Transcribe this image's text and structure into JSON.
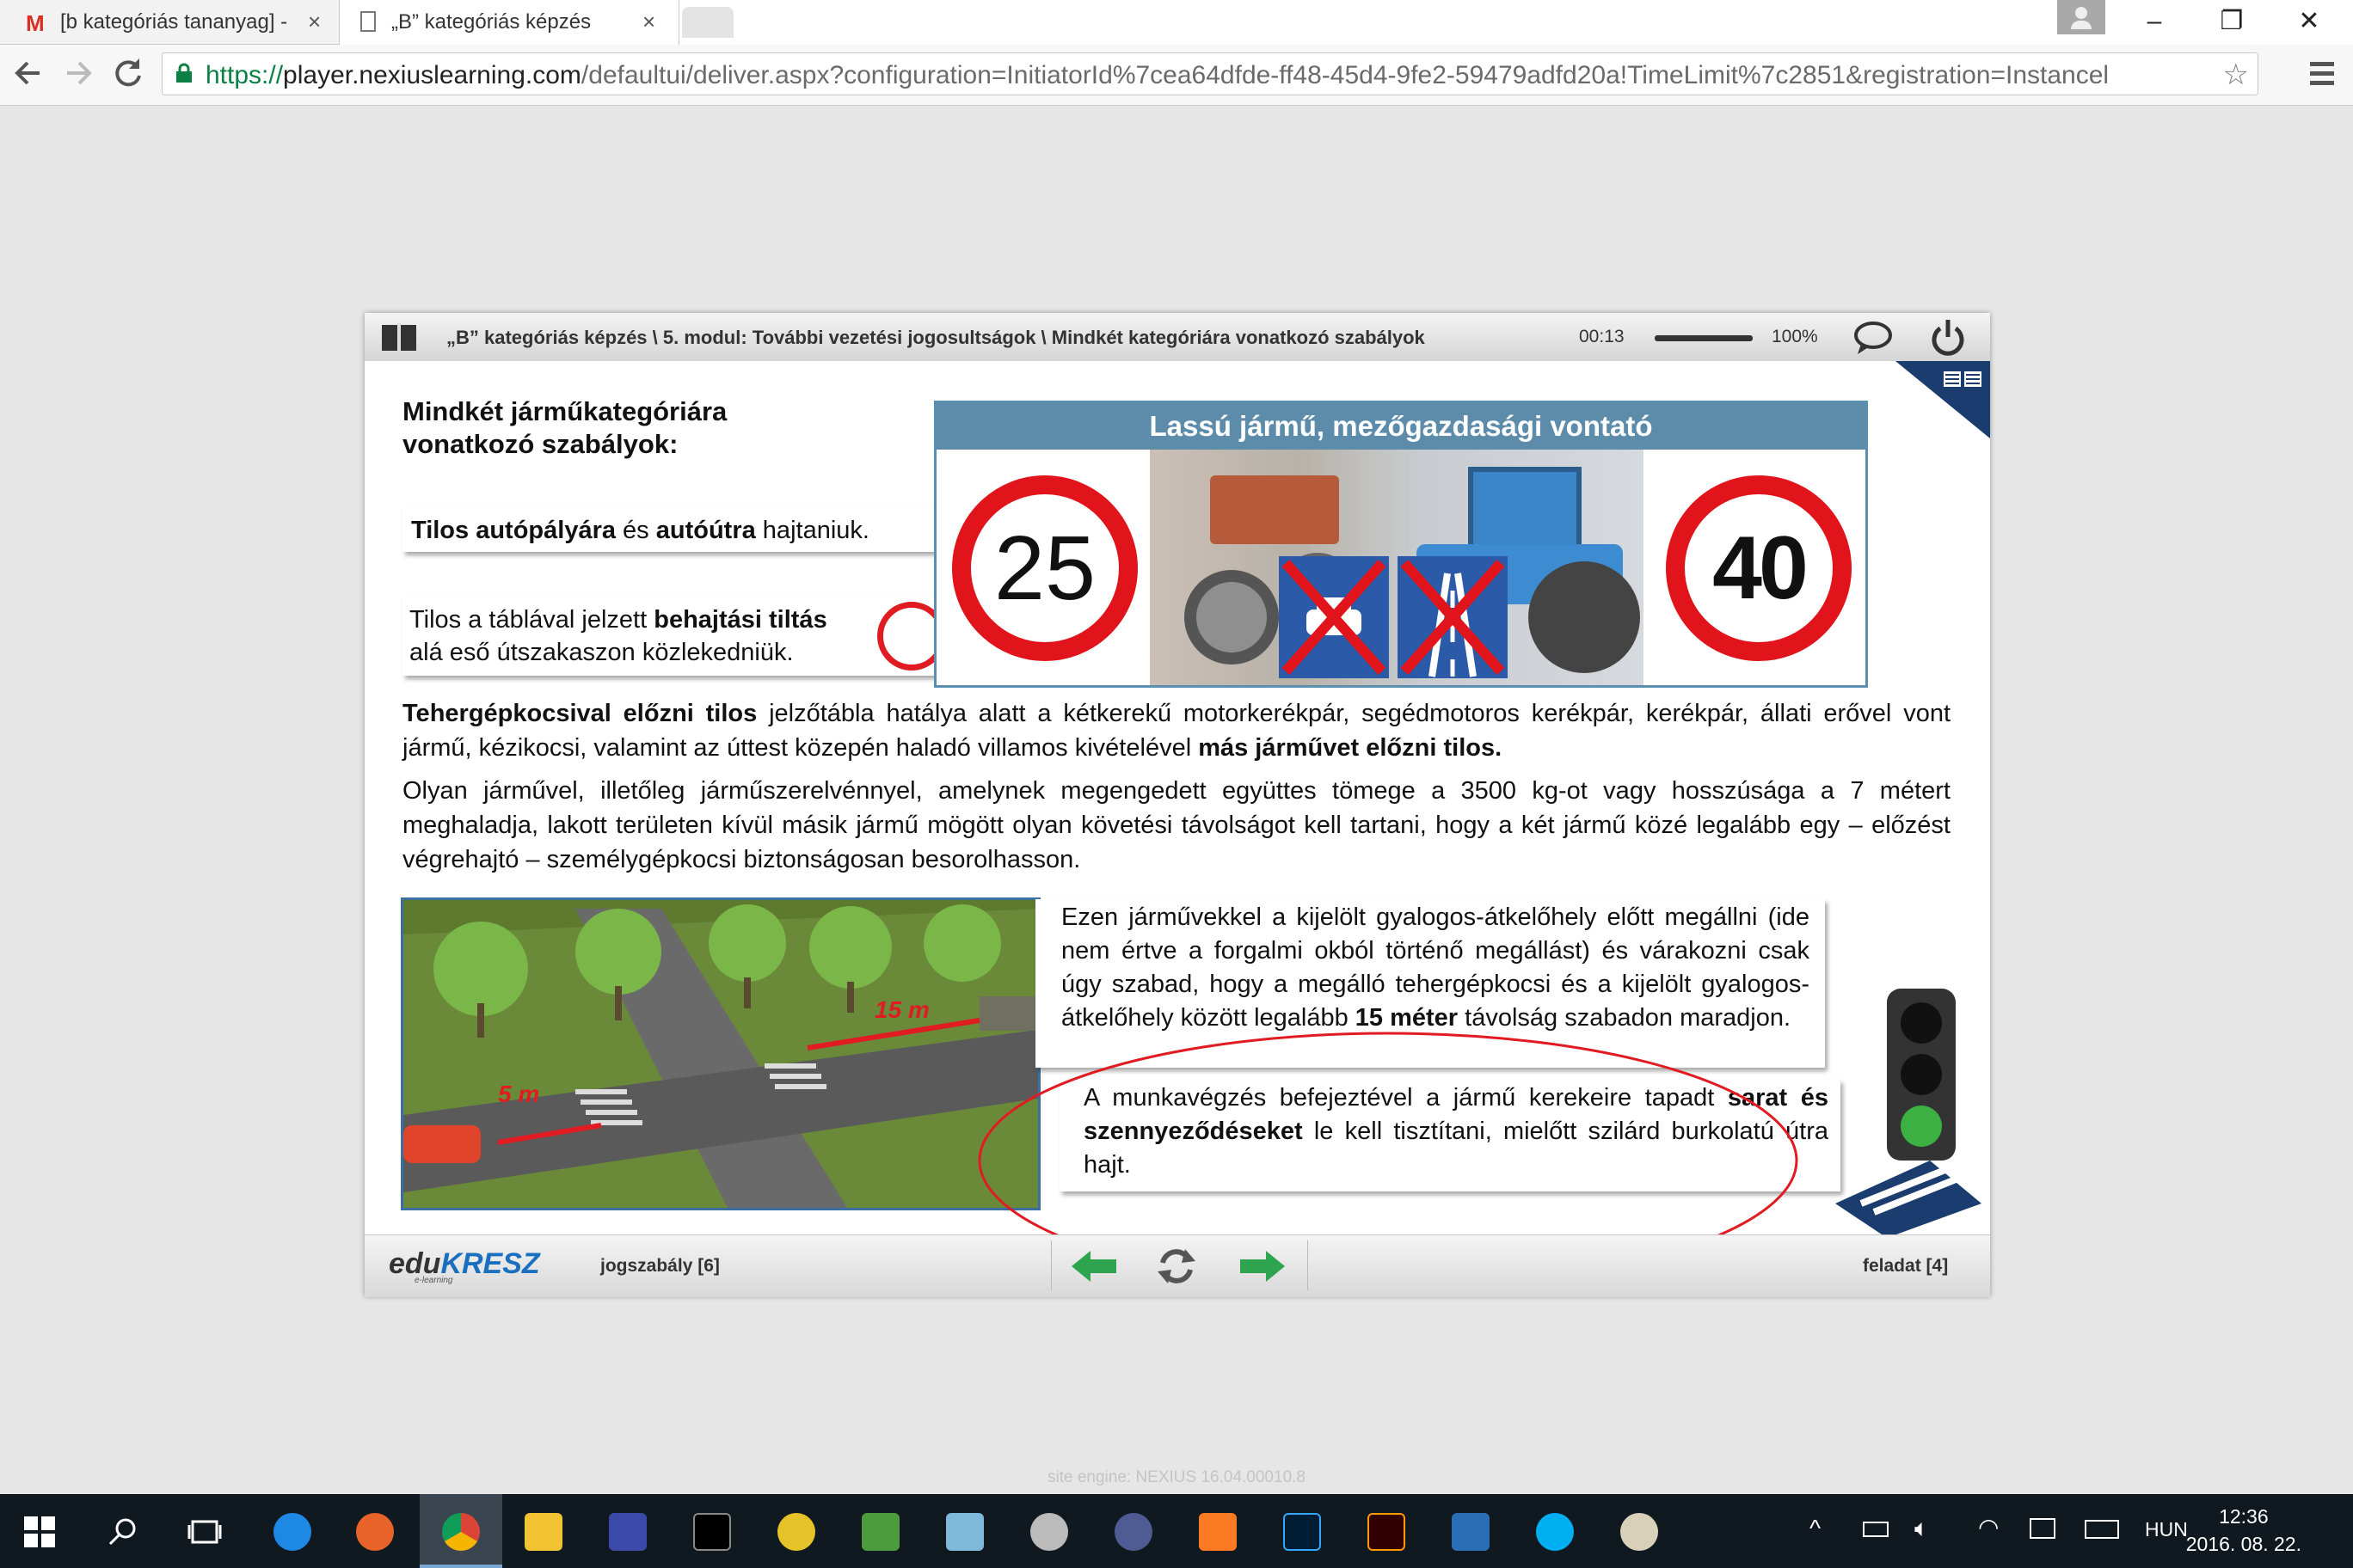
{
  "browser": {
    "tabs": [
      {
        "label": "[b kategóriás tananyag] -",
        "icon": "gmail-icon",
        "close": "×"
      },
      {
        "label": "„B” kategóriás képzés",
        "icon": "page-icon",
        "close": "×"
      }
    ],
    "url_scheme": "https://",
    "url_host": "player.nexiuslearning.com",
    "url_path": "/defaultui/deliver.aspx?configuration=InitiatorId%7cea64dfde-ff48-45d4-9fe2-59479adfd20a!TimeLimit%7c2851&registration=Instancel",
    "window_buttons": [
      "–",
      "❐",
      "✕"
    ]
  },
  "player": {
    "breadcrumb": "„B” kategóriás képzés \\ 5. modul: További vezetési jogosultságok \\ Mindkét kategóriára vonatkozó szabályok",
    "time": "00:13",
    "volume_percent": "100%",
    "footer_logo_edu": "edu",
    "footer_logo_kresz": "KRESZ",
    "footer_logo_sub": "e-learning",
    "jogszabaly_label": "jogszabály [6]",
    "feladat_label": "feladat [4]"
  },
  "content": {
    "heading_line1": "Mindkét járműkategóriára",
    "heading_line2": "vonatkozó szabályok:",
    "note1": {
      "b1": "Tilos autópályára",
      "t1": " és ",
      "b2": "autóútra",
      "t2": " hajtaniuk."
    },
    "note2": {
      "t1": "Tilos a táblával jelzett ",
      "b1": "behajtási tiltás",
      "t2": "alá eső útszakaszon közlekedniük."
    },
    "panel_title": "Lassú jármű, mezőgazdasági vontató",
    "sign_left": "25",
    "sign_right": "40",
    "para1": {
      "b1": "Tehergépkocsival előzni tilos",
      "t1": " jelzőtábla hatálya alatt a kétkerekű motorkerékpár, segédmotoros kerékpár, kerékpár, állati erővel vont jármű, kézikocsi, valamint az úttest közepén haladó villamos kivételével ",
      "b2": "más járművet előzni tilos."
    },
    "para2": "Olyan járművel, illetőleg járműszerelvénnyel, amelynek megengedett együttes tömege a 3500 kg-ot vagy hosszúsága a 7 métert meghaladja, lakott területen kívül másik jármű mögött olyan követési távolságot kell tartani, hogy a két jármű közé legalább egy – előzést végrehajtó – személygépkocsi biztonságosan besorolhasson.",
    "scene_label_5m": "5 m",
    "scene_label_15m": "15 m",
    "note3": {
      "t1": "Ezen járművekkel a kijelölt gyalogos-átkelőhely előtt megállni (ide nem értve a forgalmi okból történő megállást) és várakozni csak úgy szabad, hogy a megálló tehergépkocsi és a kijelölt gyalogos-átkelőhely között legalább ",
      "b1": "15 méter",
      "t2": " távolság szabadon maradjon."
    },
    "note4": {
      "t1": "A munkavégzés befejeztével a jármű kerekeire tapadt ",
      "b1": "sarat és szennyeződéseket",
      "t2": " le kell tisztítani, mielőtt szilárd burkolatú útra hajt."
    }
  },
  "site_engine": "site engine: NEXIUS 16.04.00010.8",
  "taskbar": {
    "lang": "HUN",
    "time": "12:36",
    "date": "2016. 08. 22."
  }
}
